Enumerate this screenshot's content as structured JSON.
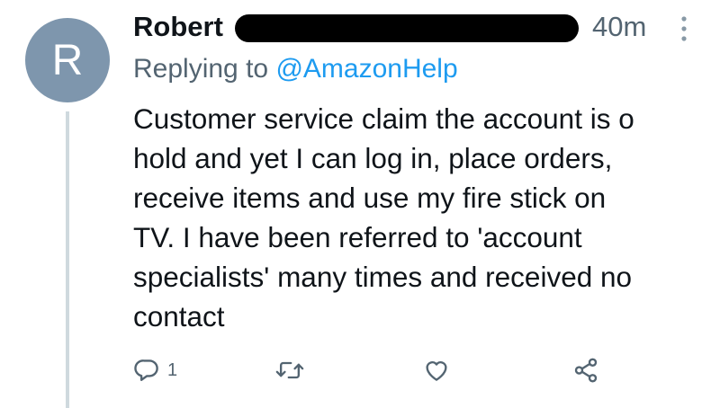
{
  "tweet": {
    "avatar_letter": "R",
    "avatar_color": "#7e96ad",
    "author_name": "Robert",
    "timestamp": "40m",
    "more_icon": "more-vertical-icon",
    "replying_prefix": "Replying to",
    "replying_to": "@AmazonHelp",
    "body_lines": [
      "Customer service claim the account is o",
      "hold and yet I can log in, place orders,",
      "receive items and use my fire stick on",
      "TV. I have been referred to 'account",
      "specialists' many times and received no",
      "contact"
    ],
    "actions": {
      "reply": {
        "icon": "reply-icon",
        "count": "1"
      },
      "retweet": {
        "icon": "retweet-icon"
      },
      "like": {
        "icon": "heart-icon"
      },
      "share": {
        "icon": "share-icon"
      }
    }
  },
  "colors": {
    "text": "#0f1419",
    "secondary_text": "#536471",
    "link": "#1d9bf0",
    "thread_line": "#cfd9de",
    "redaction": "#000000"
  }
}
